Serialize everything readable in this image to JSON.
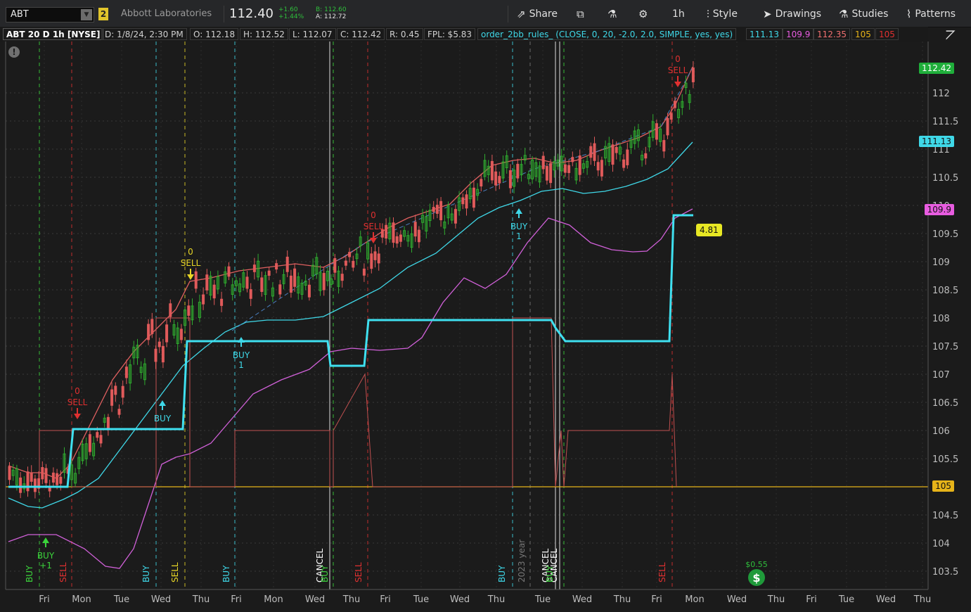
{
  "toolbar": {
    "symbol": "ABT",
    "link_group": "2",
    "company": "Abbott Laboratories",
    "last": "112.40",
    "change": "+1.60",
    "change_pct": "+1.44%",
    "bid": "B: 112.60",
    "ask": "A: 112.72",
    "share": "Share",
    "timeframe": "1h",
    "style": "Style",
    "drawings": "Drawings",
    "studies": "Studies",
    "patterns": "Patterns"
  },
  "status": {
    "title": "ABT 20 D 1h [NYSE]",
    "date": "D: 1/8/24, 2:30 PM",
    "open": "O: 112.18",
    "high": "H: 112.52",
    "low": "L: 112.07",
    "close": "C: 112.42",
    "range": "R: 0.45",
    "fpl": "FPL: $5.83",
    "strategy": "order_2bb_rules_ (CLOSE, 0, 20, -2.0, 2.0, SIMPLE, yes, yes)",
    "v1": "111.13",
    "v2": "109.9",
    "v3": "112.35",
    "v4": "105",
    "v5": "105"
  },
  "chart_data": {
    "type": "candlestick",
    "y_ticks": [
      "112",
      "111.5",
      "111",
      "110.5",
      "110",
      "109.5",
      "109",
      "108.5",
      "108",
      "107.5",
      "107",
      "106.5",
      "106",
      "105.5",
      "105",
      "104.5",
      "104",
      "103.5"
    ],
    "x_ticks": [
      "Fri",
      "Mon",
      "Tue",
      "Wed",
      "Thu",
      "Fri",
      "Mon",
      "Wed",
      "Thu",
      "Fri",
      "Tue",
      "Wed",
      "Thu",
      "Tue",
      "Wed",
      "Thu",
      "Fri",
      "Mon",
      "Wed",
      "Thu",
      "Fri",
      "Tue",
      "Wed",
      "Thu"
    ],
    "price_tags": [
      {
        "label": "112.42",
        "color": "#1fae3a"
      },
      {
        "label": "111.13",
        "color": "#3fd8e8"
      },
      {
        "label": "109.9",
        "color": "#e85ce0"
      },
      {
        "label": "105",
        "color": "#e6b319"
      }
    ],
    "pl_label": "4.81",
    "signals": [
      {
        "text": "BUY",
        "sub": "+1",
        "color": "#3bd43b"
      },
      {
        "text": "SELL",
        "sub": "0",
        "color": "#e03030"
      },
      {
        "text": "BUY",
        "color": "#3fd8e8"
      },
      {
        "text": "SELL",
        "sub": "0",
        "color": "#e8d626"
      },
      {
        "text": "BUY",
        "sub": "1",
        "color": "#3fd8e8"
      },
      {
        "text": "SELL",
        "sub": "0",
        "color": "#e03030"
      },
      {
        "text": "BUY",
        "sub": "1",
        "color": "#3fd8e8"
      },
      {
        "text": "SELL",
        "sub": "0",
        "color": "#e03030"
      }
    ],
    "vertical_labels": [
      "BUY",
      "SELL",
      "BUY",
      "SELL",
      "BUY",
      "CANCEL",
      "BUY",
      "SELL",
      "BUY",
      "2023 year",
      "CANCEL",
      "CANCEL",
      "BUY",
      "SELL"
    ],
    "profit_label": "$0.55"
  }
}
